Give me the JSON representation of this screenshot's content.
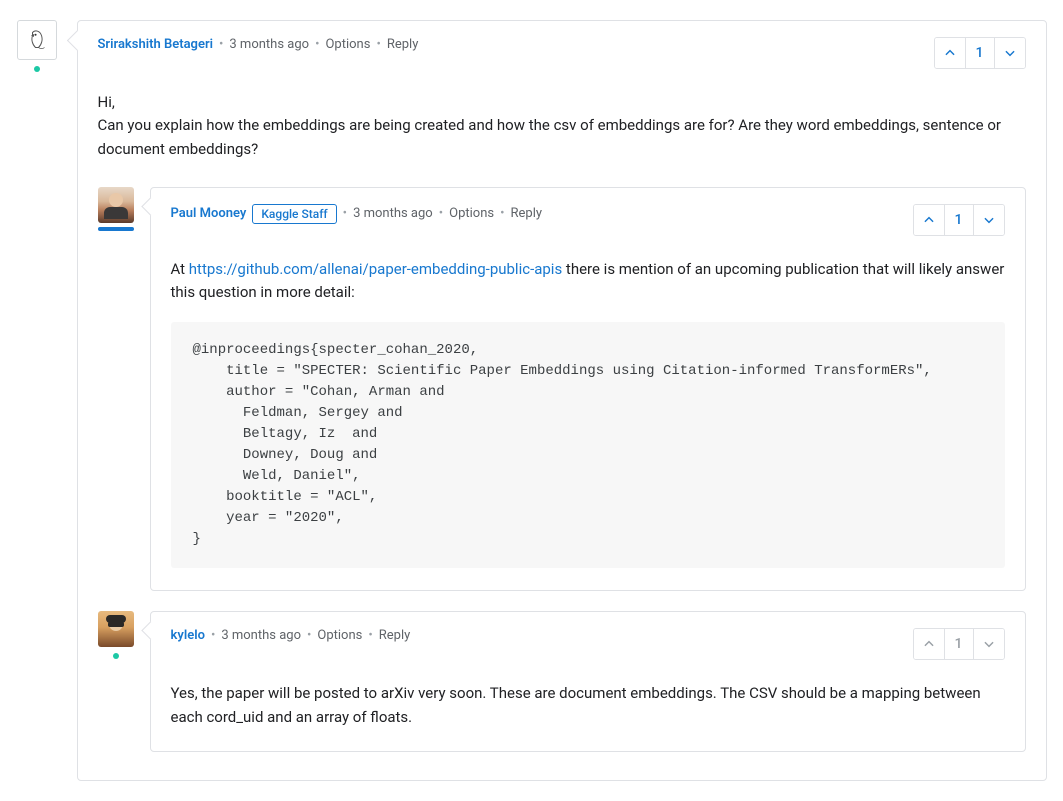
{
  "top": {
    "author": "Srirakshith Betageri",
    "time": "3 months ago",
    "options": "Options",
    "reply": "Reply",
    "votes": "1",
    "text_line1": "Hi,",
    "text_line2": "Can you explain how the embeddings are being created and how the csv of embeddings are for? Are they word embeddings, sentence or document embeddings?"
  },
  "reply1": {
    "author": "Paul Mooney",
    "badge": "Kaggle Staff",
    "time": "3 months ago",
    "options": "Options",
    "reply": "Reply",
    "votes": "1",
    "text_prefix": "At ",
    "link_text": "https://github.com/allenai/paper-embedding-public-apis",
    "text_suffix": " there is mention of an upcoming publication that will likely answer this question in more detail:",
    "code": "@inproceedings{specter_cohan_2020,\n    title = \"SPECTER: Scientific Paper Embeddings using Citation-informed TransformERs\",\n    author = \"Cohan, Arman and\n      Feldman, Sergey and\n      Beltagy, Iz  and\n      Downey, Doug and\n      Weld, Daniel\",\n    booktitle = \"ACL\",\n    year = \"2020\",\n}"
  },
  "reply2": {
    "author": "kylelo",
    "time": "3 months ago",
    "options": "Options",
    "reply": "Reply",
    "votes": "1",
    "text": "Yes, the paper will be posted to arXiv very soon. These are document embeddings. The CSV should be a mapping between each cord_uid and an array of floats."
  }
}
